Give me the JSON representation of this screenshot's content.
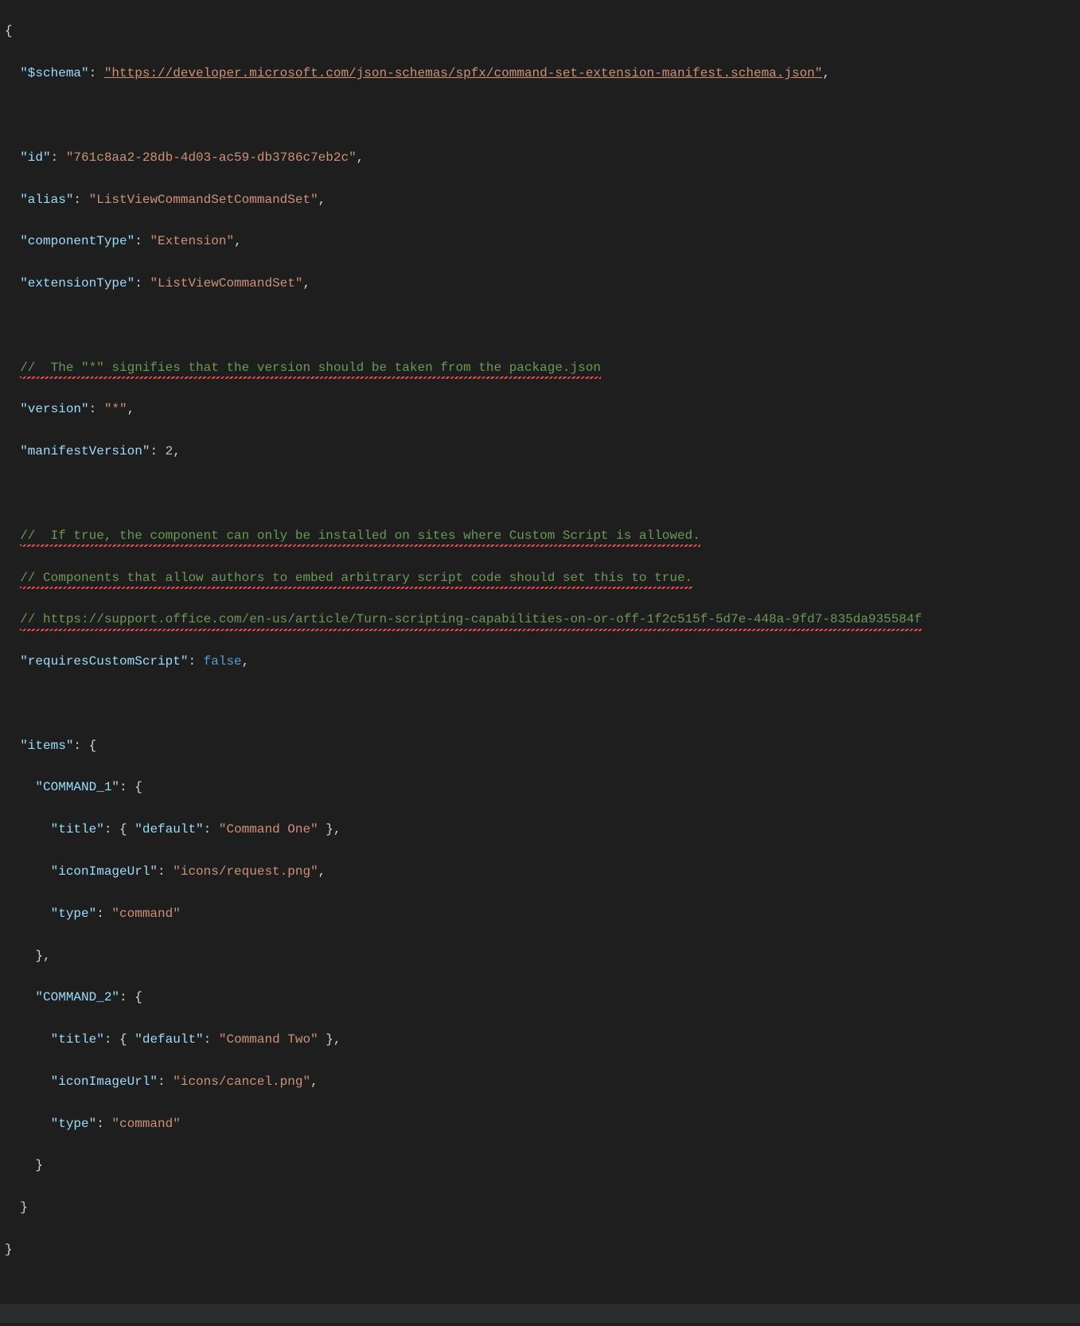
{
  "code": {
    "open_brace": "{",
    "schema_key": "\"$schema\"",
    "schema_val": "\"https://developer.microsoft.com/json-schemas/spfx/command-set-extension-manifest.schema.json\"",
    "id_key": "\"id\"",
    "id_val": "\"761c8aa2-28db-4d03-ac59-db3786c7eb2c\"",
    "alias_key": "\"alias\"",
    "alias_val": "\"ListViewCommandSetCommandSet\"",
    "componentType_key": "\"componentType\"",
    "componentType_val": "\"Extension\"",
    "extensionType_key": "\"extensionType\"",
    "extensionType_val": "\"ListViewCommandSet\"",
    "comment_version": "//  The \"*\" signifies that the version should be taken from the package.json",
    "version_key": "\"version\"",
    "version_val": "\"*\"",
    "manifestVersion_key": "\"manifestVersion\"",
    "manifestVersion_val": "2",
    "comment_cs1": "//  If true, the component can only be installed on sites where Custom Script is allowed.",
    "comment_cs2": "// Components that allow authors to embed arbitrary script code should set this to true.",
    "comment_cs3": "// https://support.office.com/en-us/article/Turn-scripting-capabilities-on-or-off-1f2c515f-5d7e-448a-9fd7-835da935584f",
    "requiresCustomScript_key": "\"requiresCustomScript\"",
    "requiresCustomScript_val": "false",
    "items_key": "\"items\"",
    "cmd1_key": "\"COMMAND_1\"",
    "title_key": "\"title\"",
    "default_key": "\"default\"",
    "cmd1_title_val": "\"Command One\"",
    "iconImageUrl_key": "\"iconImageUrl\"",
    "cmd1_icon_val": "\"icons/request.png\"",
    "type_key": "\"type\"",
    "type_val": "\"command\"",
    "cmd2_key": "\"COMMAND_2\"",
    "cmd2_title_val": "\"Command Two\"",
    "cmd2_icon_val": "\"icons/cancel.png\"",
    "close_brace": "}",
    "colon": ":",
    "comma": ",",
    "obrace": "{",
    "cbrace": "}"
  }
}
